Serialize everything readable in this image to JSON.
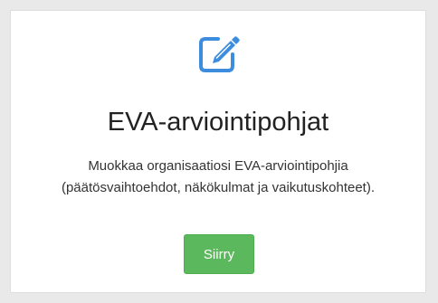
{
  "card": {
    "icon": "edit-icon",
    "icon_color": "#3c8dde",
    "title": "EVA-arviointipohjat",
    "description": "Muokkaa organisaatiosi EVA-arviointipohjia (päätösvaihtoehdot, näkökulmat ja vaikutuskohteet).",
    "button_label": "Siirry",
    "button_color": "#5cb85c"
  }
}
